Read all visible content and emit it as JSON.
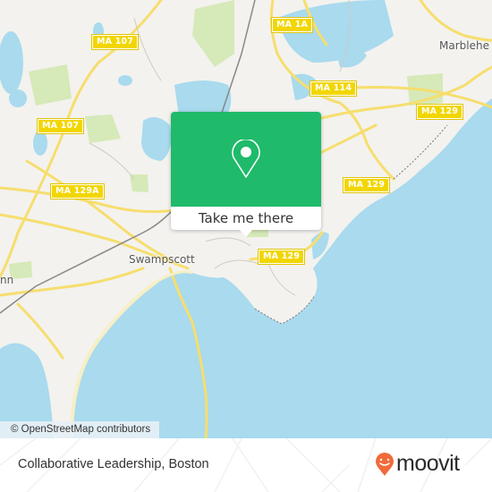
{
  "map": {
    "shields": [
      {
        "id": "ma-107-top",
        "label": "MA 107"
      },
      {
        "id": "ma-107-left",
        "label": "MA 107"
      },
      {
        "id": "ma-129a",
        "label": "MA 129A"
      },
      {
        "id": "ma-1a",
        "label": "MA 1A"
      },
      {
        "id": "ma-114",
        "label": "MA 114"
      },
      {
        "id": "ma-129-east",
        "label": "MA 129"
      },
      {
        "id": "ma-129-mid",
        "label": "MA 129"
      },
      {
        "id": "ma-129-south",
        "label": "MA 129"
      }
    ],
    "places": [
      {
        "id": "swampscott",
        "label": "Swampscott"
      },
      {
        "id": "marblehead",
        "label": "Marblehe"
      },
      {
        "id": "lynn",
        "label": "nn"
      }
    ],
    "colors": {
      "land": "#f3f2ee",
      "water": "#a9daee",
      "road": "#f6de6e",
      "park": "#d6e9b8",
      "accent": "#1fba6a",
      "brand": "#f26a3a"
    }
  },
  "popup": {
    "icon": "map-pin-icon",
    "button_label": "Take me there"
  },
  "attribution": "© OpenStreetMap contributors",
  "footer": {
    "title": "Collaborative Leadership, Boston",
    "logo_text": "moovit",
    "logo_icon": "moovit-pin-icon"
  }
}
